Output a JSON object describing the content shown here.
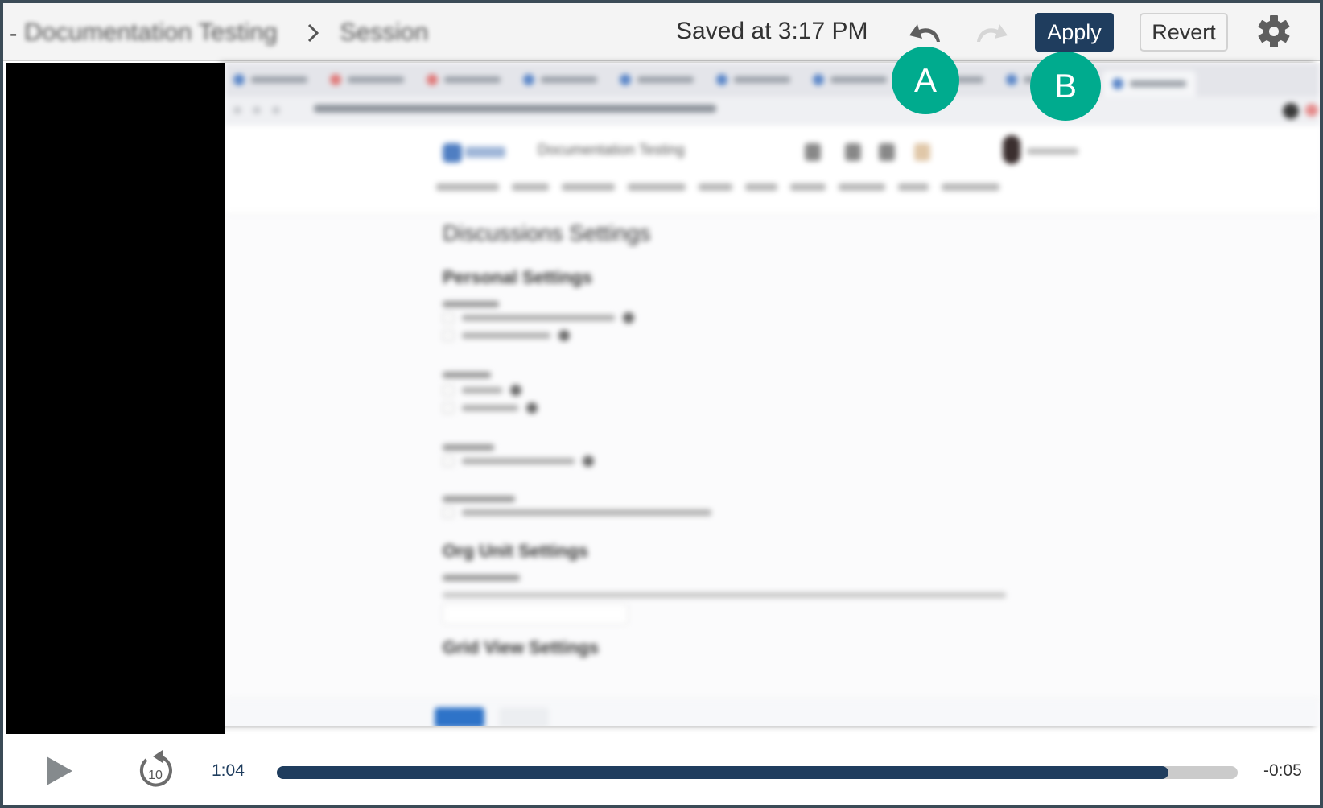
{
  "topbar": {
    "breadcrumb_prefix": "-",
    "breadcrumb": [
      "Documentation Testing",
      "Session"
    ],
    "saved_status": "Saved at 3:17 PM",
    "undo_icon": "undo-icon",
    "redo_icon": "redo-icon",
    "apply_label": "Apply",
    "revert_label": "Revert",
    "settings_icon": "gear-icon"
  },
  "callouts": {
    "a": "A",
    "b": "B",
    "color": "#00ab8e"
  },
  "recording": {
    "blurred": true,
    "page_title": "Documentation Testing",
    "heading": "Discussions Settings",
    "sections": [
      "Personal Settings",
      "Org Unit Settings",
      "Grid View Settings"
    ]
  },
  "player": {
    "play_icon": "play-icon",
    "rewind_icon": "rewind-10-icon",
    "rewind_seconds": "10",
    "elapsed": "1:04",
    "remaining": "-0:05",
    "progress_fraction": 0.928,
    "accent_color": "#1f3d5e"
  },
  "colors": {
    "frame_border": "#3b4b57",
    "apply_bg": "#1f3d5e",
    "track_bg": "#cbcbcb"
  }
}
